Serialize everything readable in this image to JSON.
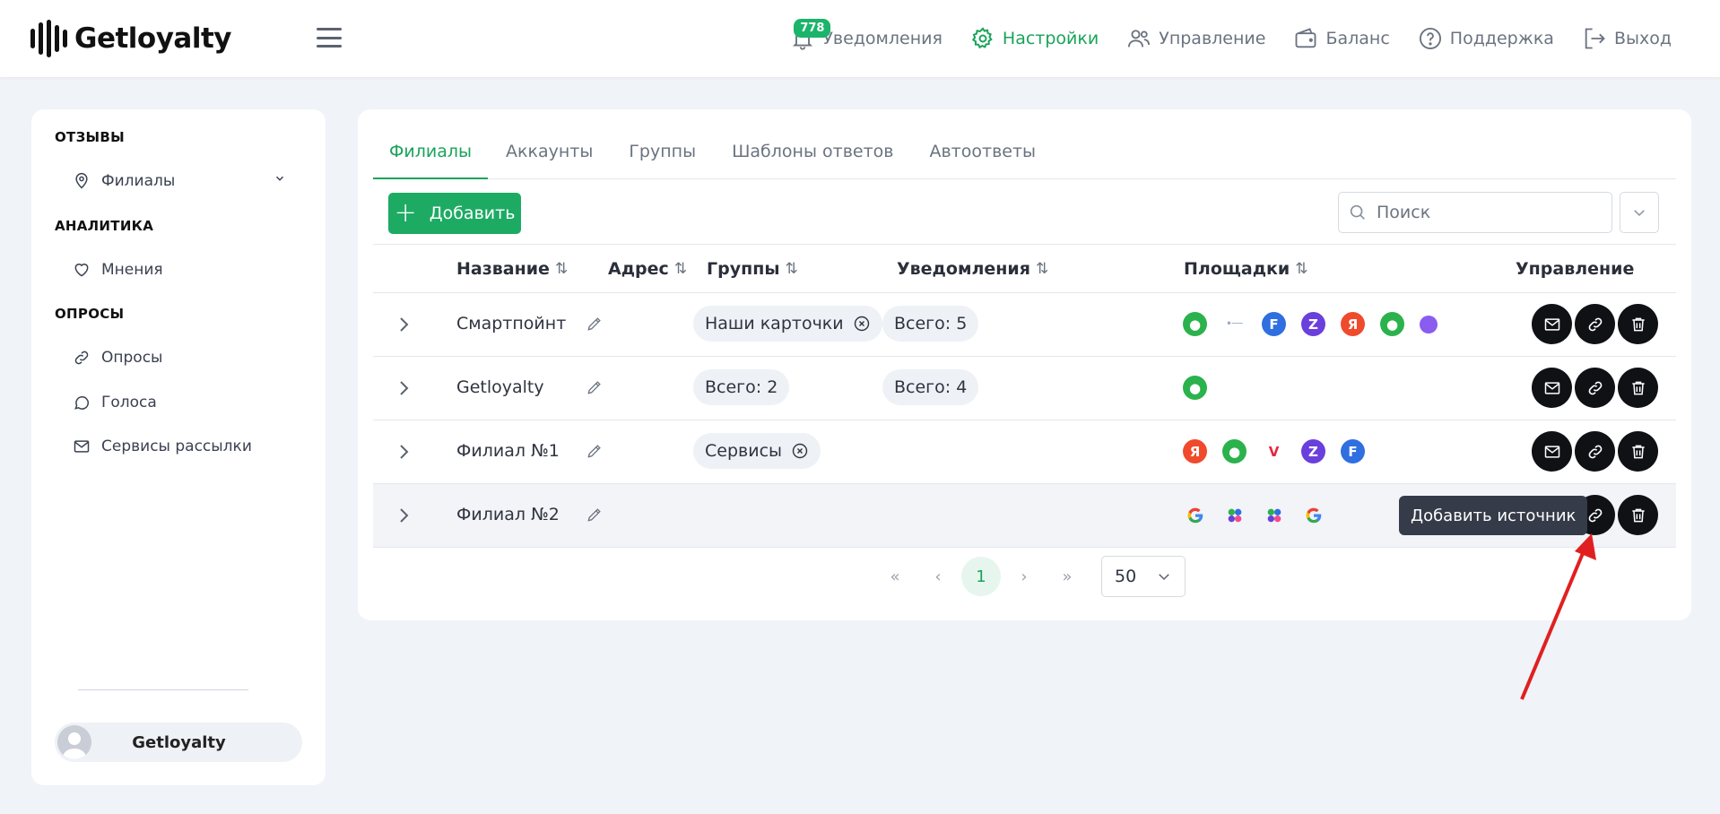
{
  "header": {
    "logo_text": "Getloyalty",
    "notif_count": "778",
    "nav": [
      {
        "label": "Уведомления",
        "icon": "bell-icon"
      },
      {
        "label": "Настройки",
        "icon": "gear-icon",
        "active": true
      },
      {
        "label": "Управление",
        "icon": "users-icon"
      },
      {
        "label": "Баланс",
        "icon": "wallet-icon"
      },
      {
        "label": "Поддержка",
        "icon": "help-circle-icon"
      },
      {
        "label": "Выход",
        "icon": "logout-icon"
      }
    ]
  },
  "sidebar": {
    "sections": [
      "ОТЗЫВЫ",
      "АНАЛИТИКА",
      "ОПРОСЫ"
    ],
    "items": [
      {
        "label": "Филиалы",
        "icon": "map-pin-icon"
      },
      {
        "label": "Мнения",
        "icon": "heart-icon"
      },
      {
        "label": "Опросы",
        "icon": "link-icon"
      },
      {
        "label": "Голоса",
        "icon": "chat-bubble-icon"
      },
      {
        "label": "Сервисы рассылки",
        "icon": "mail-icon"
      }
    ],
    "profile_name": "Getloyalty"
  },
  "tabs": [
    "Филиалы",
    "Аккаунты",
    "Группы",
    "Шаблоны ответов",
    "Автоответы"
  ],
  "toolbar": {
    "add_label": "Добавить",
    "search_placeholder": "Поиск"
  },
  "table": {
    "columns": [
      "Название",
      "Адрес",
      "Группы",
      "Уведомления",
      "Площадки",
      "Управление"
    ],
    "rows": [
      {
        "name": "Смартпойнт",
        "group": "Наши карточки",
        "group_removable": true,
        "notif": "Всего: 5",
        "platforms": [
          "2gis",
          "flamp",
          "tf",
          "zoon",
          "yandex",
          "2gis",
          "other"
        ]
      },
      {
        "name": "Getloyalty",
        "group": "Всего: 2",
        "group_removable": false,
        "notif": "Всего: 4",
        "platforms": [
          "2gis"
        ]
      },
      {
        "name": "Филиал №1",
        "group": "Сервисы",
        "group_removable": true,
        "notif": "",
        "platforms": [
          "yandex",
          "2gis",
          "vk",
          "zoon",
          "tf"
        ]
      },
      {
        "name": "Филиал №2",
        "group": "",
        "group_removable": false,
        "notif": "",
        "platforms": [
          "google",
          "dots",
          "dots",
          "google"
        ]
      }
    ]
  },
  "tooltip": "Добавить источник",
  "pagination": {
    "current": "1",
    "per_page": "50"
  },
  "colors": {
    "accent": "#19a35a",
    "annotation_arrow": "#e02020"
  }
}
